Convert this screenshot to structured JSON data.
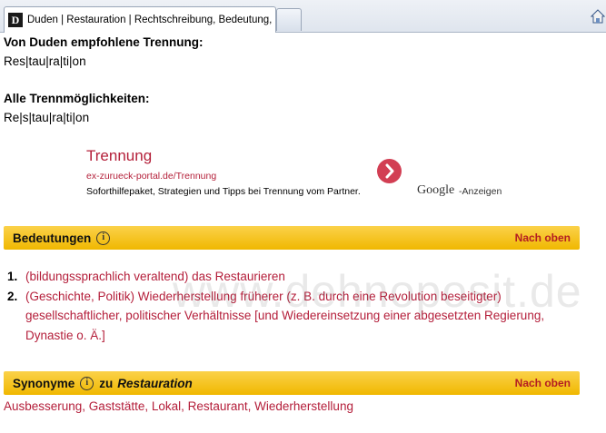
{
  "browser": {
    "tab_title": "Duden | Restauration | Rechtschreibung, Bedeutung, ...",
    "favicon_letter": "D"
  },
  "trennung": {
    "recommended_heading": "Von Duden empfohlene Trennung:",
    "recommended_value": "Res|tau|ra|ti|on",
    "all_heading": "Alle Trennmöglichkeiten:",
    "all_value": "Re|s|tau|ra|ti|on"
  },
  "ad": {
    "title": "Trennung",
    "url": "ex-zurueck-portal.de/Trennung",
    "description": "Soforthilfepaket, Strategien und Tipps bei Trennung vom Partner.",
    "brand": "Google",
    "suffix": "-Anzeigen"
  },
  "bedeutungen": {
    "title": "Bedeutungen",
    "info": "i",
    "top_link": "Nach oben",
    "items": [
      {
        "num": "1.",
        "text": "(bildungssprachlich veraltend) das Restaurieren"
      },
      {
        "num": "2.",
        "text": "(Geschichte, Politik) Wiederherstellung früherer (z. B. durch eine Revolution beseitigter) gesellschaftlicher, politischer Verhältnisse [und Wiedereinsetzung einer abgesetzten Regierung, Dynastie o. Ä.]"
      }
    ]
  },
  "synonyme": {
    "title_prefix": "Synonyme",
    "info": "i",
    "title_middle": "zu",
    "title_word": "Restauration",
    "top_link": "Nach oben",
    "list": "Ausbesserung, Gaststätte, Lokal, Restaurant, Wiederherstellung"
  },
  "watermark": "www.dehnoposit.de",
  "colors": {
    "accent_red": "#b41e3a",
    "section_yellow": "#f5c518"
  }
}
